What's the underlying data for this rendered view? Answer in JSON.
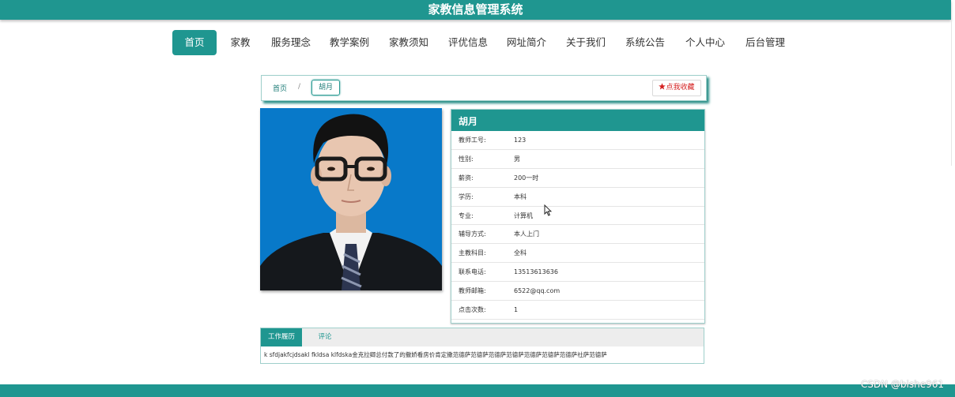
{
  "header": {
    "title": "家教信息管理系统"
  },
  "nav": {
    "items": [
      {
        "label": "首页",
        "active": true
      },
      {
        "label": "家教"
      },
      {
        "label": "服务理念"
      },
      {
        "label": "教学案例"
      },
      {
        "label": "家教须知"
      },
      {
        "label": "评优信息"
      },
      {
        "label": "网址简介"
      },
      {
        "label": "关于我们"
      },
      {
        "label": "系统公告"
      },
      {
        "label": "个人中心"
      },
      {
        "label": "后台管理"
      }
    ]
  },
  "breadcrumb": {
    "home": "首页",
    "separator": "/",
    "current": "胡月"
  },
  "favorite_button": {
    "label": "点我收藏",
    "icon": "star-icon"
  },
  "teacher": {
    "name": "胡月",
    "fields": [
      {
        "label": "教师工号:",
        "value": "123"
      },
      {
        "label": "性别:",
        "value": "男"
      },
      {
        "label": "薪资:",
        "value": "200一时"
      },
      {
        "label": "学历:",
        "value": "本科"
      },
      {
        "label": "专业:",
        "value": "计算机"
      },
      {
        "label": "辅导方式:",
        "value": "本人上门"
      },
      {
        "label": "主教科目:",
        "value": "全科"
      },
      {
        "label": "联系电话:",
        "value": "13513613636"
      },
      {
        "label": "教师邮箱:",
        "value": "6522@qq.com"
      },
      {
        "label": "点击次数:",
        "value": "1"
      }
    ]
  },
  "tabs": {
    "items": [
      {
        "label": "工作履历",
        "active": true
      },
      {
        "label": "评论"
      }
    ],
    "content": "k sfdjakfcjdsakl fkldsa klfdska金克拉卿总付款了的撒娇看房价肯定撒范德萨范德萨范德萨范德萨范德萨范德萨范德萨社萨范德萨"
  },
  "watermark": "CSDN @bishe961",
  "colors": {
    "primary": "#1f9690",
    "favorite_red": "#d42020",
    "photo_bg": "#0879c9"
  }
}
